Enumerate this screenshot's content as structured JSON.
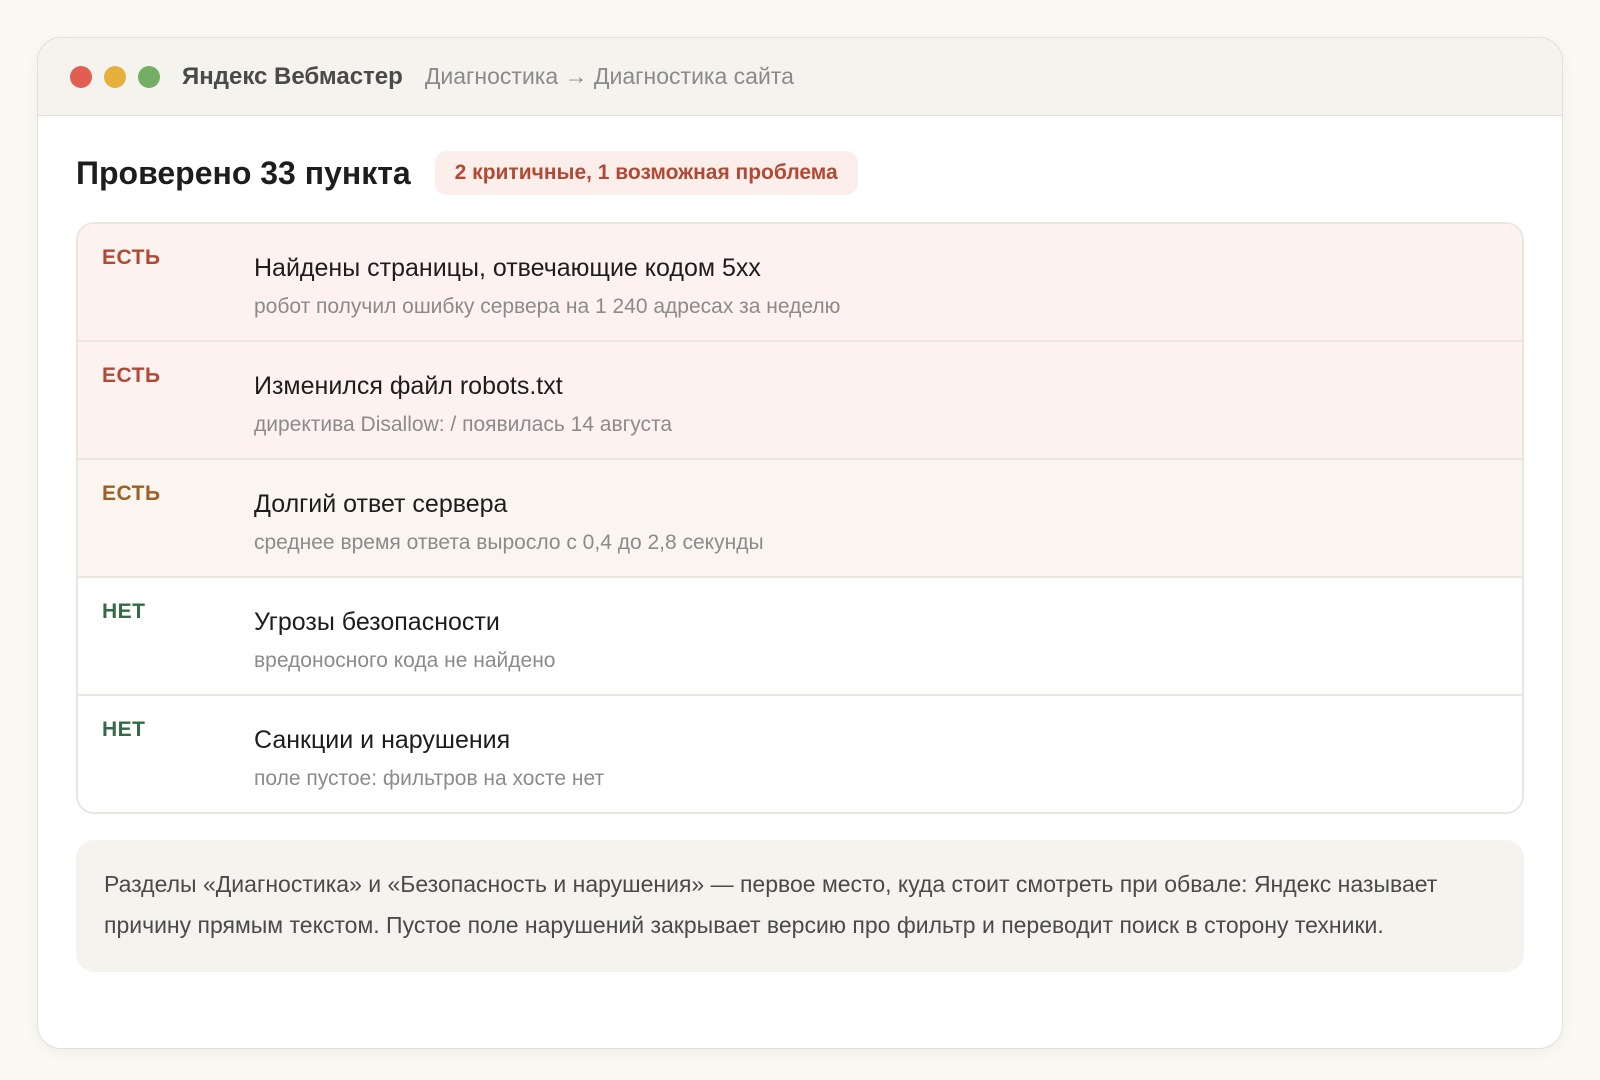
{
  "window": {
    "app_name": "Яндекс Вебмастер",
    "breadcrumb": "Диагностика → Диагностика сайта"
  },
  "colors": {
    "critical": "#b04a34",
    "warning": "#9b6026",
    "ok": "#336b45"
  },
  "header": {
    "title": "Проверено 33 пункта",
    "summary_badge": "2 критичные, 1 возможная проблема"
  },
  "checks": [
    {
      "status": "ЕСТЬ",
      "severity": "critical",
      "title": "Найдены страницы, отвечающие кодом 5xx",
      "detail": "робот получил ошибку сервера на 1 240 адресах за неделю"
    },
    {
      "status": "ЕСТЬ",
      "severity": "critical",
      "title": "Изменился файл robots.txt",
      "detail": "директива Disallow: / появилась 14 августа"
    },
    {
      "status": "ЕСТЬ",
      "severity": "warning",
      "title": "Долгий ответ сервера",
      "detail": "среднее время ответа выросло с 0,4 до 2,8 секунды"
    },
    {
      "status": "НЕТ",
      "severity": "ok",
      "title": "Угрозы безопасности",
      "detail": "вредоносного кода не найдено"
    },
    {
      "status": "НЕТ",
      "severity": "ok",
      "title": "Санкции и нарушения",
      "detail": "поле пустое: фильтров на хосте нет"
    }
  ],
  "note": "Разделы «Диагностика» и «Безопасность и нарушения» — первое место, куда стоит смотреть при обвале: Яндекс называет причину прямым текстом. Пустое поле нарушений закрывает версию про фильтр и переводит поиск в сторону техники."
}
